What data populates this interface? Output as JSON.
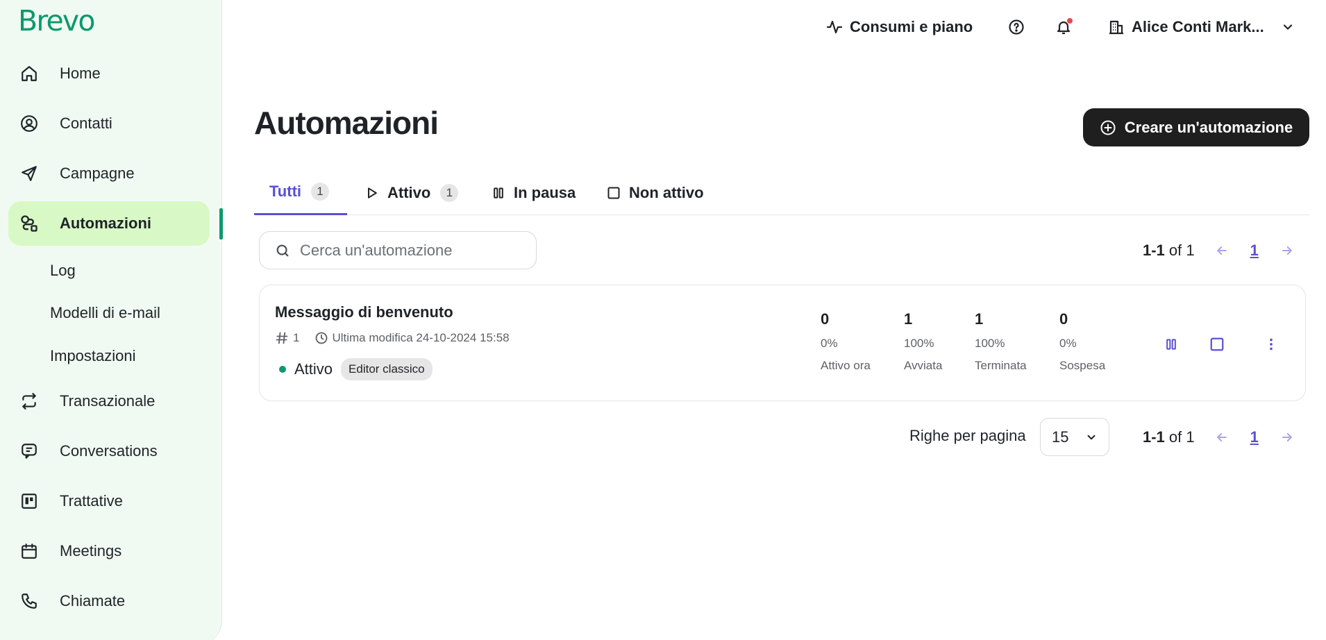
{
  "brand": {
    "logo": "Brevo",
    "accent": "#0b996e",
    "sidebar_bg": "#f0faf2",
    "active_bg": "#d8f9c5",
    "primary": "#5a4fd4"
  },
  "sidebar": {
    "items": [
      {
        "label": "Home",
        "icon": "home-icon"
      },
      {
        "label": "Contatti",
        "icon": "contact-icon"
      },
      {
        "label": "Campagne",
        "icon": "send-icon"
      },
      {
        "label": "Automazioni",
        "icon": "automation-icon",
        "active": true
      },
      {
        "label": "Transazionale",
        "icon": "transactional-icon"
      },
      {
        "label": "Conversations",
        "icon": "chat-icon"
      },
      {
        "label": "Trattative",
        "icon": "deals-icon"
      },
      {
        "label": "Meetings",
        "icon": "calendar-icon"
      },
      {
        "label": "Chiamate",
        "icon": "phone-icon"
      }
    ],
    "subitems": [
      "Log",
      "Modelli di e-mail",
      "Impostazioni"
    ]
  },
  "topbar": {
    "usage": "Consumi e piano",
    "account": "Alice Conti Mark..."
  },
  "page": {
    "title": "Automazioni",
    "create_button": "Creare un'automazione",
    "tabs": [
      {
        "label": "Tutti",
        "count": "1",
        "active": true
      },
      {
        "label": "Attivo",
        "count": "1"
      },
      {
        "label": "In pausa"
      },
      {
        "label": "Non attivo"
      }
    ],
    "search_placeholder": "Cerca un'automazione",
    "pagination": {
      "range": "1-1",
      "of_text": "of 1",
      "page": "1"
    },
    "rows_per_page_label": "Righe per pagina",
    "rows_per_page_value": "15"
  },
  "automations": [
    {
      "name": "Messaggio di benvenuto",
      "id": "1",
      "last_modified": "Ultima modifica 24-10-2024 15:58",
      "status": "Attivo",
      "editor": "Editor classico",
      "stats": [
        {
          "value": "0",
          "percent": "0%",
          "label": "Attivo ora"
        },
        {
          "value": "1",
          "percent": "100%",
          "label": "Avviata"
        },
        {
          "value": "1",
          "percent": "100%",
          "label": "Terminata"
        },
        {
          "value": "0",
          "percent": "0%",
          "label": "Sospesa"
        }
      ]
    }
  ]
}
